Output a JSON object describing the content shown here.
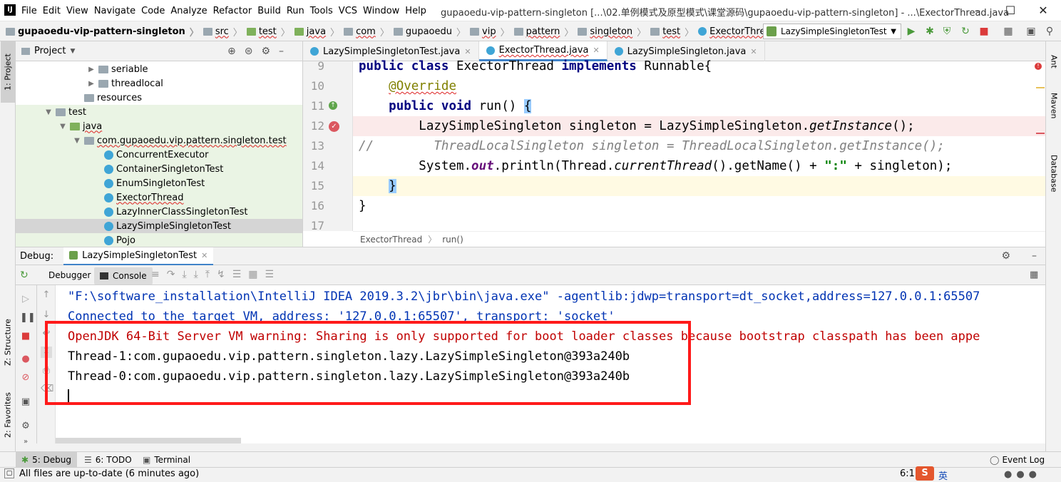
{
  "window": {
    "title": "gupaoedu-vip-pattern-singleton [...\\02.单例模式及原型模式\\课堂源码\\gupaoedu-vip-pattern-singleton] - ...\\ExectorThread.java",
    "menus": [
      "File",
      "Edit",
      "View",
      "Navigate",
      "Code",
      "Analyze",
      "Refactor",
      "Build",
      "Run",
      "Tools",
      "VCS",
      "Window",
      "Help"
    ]
  },
  "breadcrumbs": [
    "gupaoedu-vip-pattern-singleton",
    "src",
    "test",
    "java",
    "com",
    "gupaoedu",
    "vip",
    "pattern",
    "singleton",
    "test",
    "ExectorThread"
  ],
  "run_config": "LazySimpleSingletonTest",
  "left_strip": {
    "project_tab": "1: Project",
    "structure_tab": "Z: Structure",
    "favorites_tab": "2: Favorites"
  },
  "right_strip": {
    "ant": "Ant",
    "maven": "Maven",
    "database": "Database"
  },
  "project": {
    "header": "Project",
    "items": [
      {
        "label": "seriable",
        "kind": "folder"
      },
      {
        "label": "threadlocal",
        "kind": "folder"
      },
      {
        "label": "resources",
        "kind": "folder"
      },
      {
        "label": "test",
        "kind": "folder"
      },
      {
        "label": "java",
        "kind": "folder"
      },
      {
        "label": "com.gupaoedu.vip.pattern.singleton.test",
        "kind": "package"
      },
      {
        "label": "ConcurrentExecutor",
        "kind": "class"
      },
      {
        "label": "ContainerSingletonTest",
        "kind": "class"
      },
      {
        "label": "EnumSingletonTest",
        "kind": "class"
      },
      {
        "label": "ExectorThread",
        "kind": "class"
      },
      {
        "label": "LazyInnerClassSingletonTest",
        "kind": "class"
      },
      {
        "label": "LazySimpleSingletonTest",
        "kind": "class"
      },
      {
        "label": "Pojo",
        "kind": "class"
      }
    ]
  },
  "editor": {
    "tabs": [
      "LazySimpleSingletonTest.java",
      "ExectorThread.java",
      "LazySimpleSingleton.java"
    ],
    "line_numbers": [
      "9",
      "10",
      "11",
      "12",
      "13",
      "14",
      "15",
      "16",
      "17"
    ],
    "code_breadcrumb": [
      "ExectorThread",
      "run()"
    ]
  },
  "debug": {
    "label": "Debug:",
    "session": "LazySimpleSingletonTest",
    "tab_debugger": "Debugger",
    "tab_console": "Console",
    "console_lines": [
      "\"F:\\software_installation\\IntelliJ IDEA 2019.3.2\\jbr\\bin\\java.exe\" -agentlib:jdwp=transport=dt_socket,address=127.0.0.1:65507",
      "Connected to the target VM, address: '127.0.0.1:65507', transport: 'socket'",
      "OpenJDK 64-Bit Server VM warning: Sharing is only supported for boot loader classes because bootstrap classpath has been appe",
      "Thread-1:com.gupaoedu.vip.pattern.singleton.lazy.LazySimpleSingleton@393a240b",
      "Thread-0:com.gupaoedu.vip.pattern.singleton.lazy.LazySimpleSingleton@393a240b"
    ]
  },
  "bottom_tabs": [
    "5: Debug",
    "6: TODO",
    "Terminal"
  ],
  "event_log": "Event Log",
  "status": {
    "message": "All files are up-to-date (6 minutes ago)",
    "position": "6:1",
    "ime": "英"
  },
  "colors": {
    "accent": "#4083c9",
    "highlight_box": "#ff1a1a",
    "breakpoint": "#db5860"
  }
}
